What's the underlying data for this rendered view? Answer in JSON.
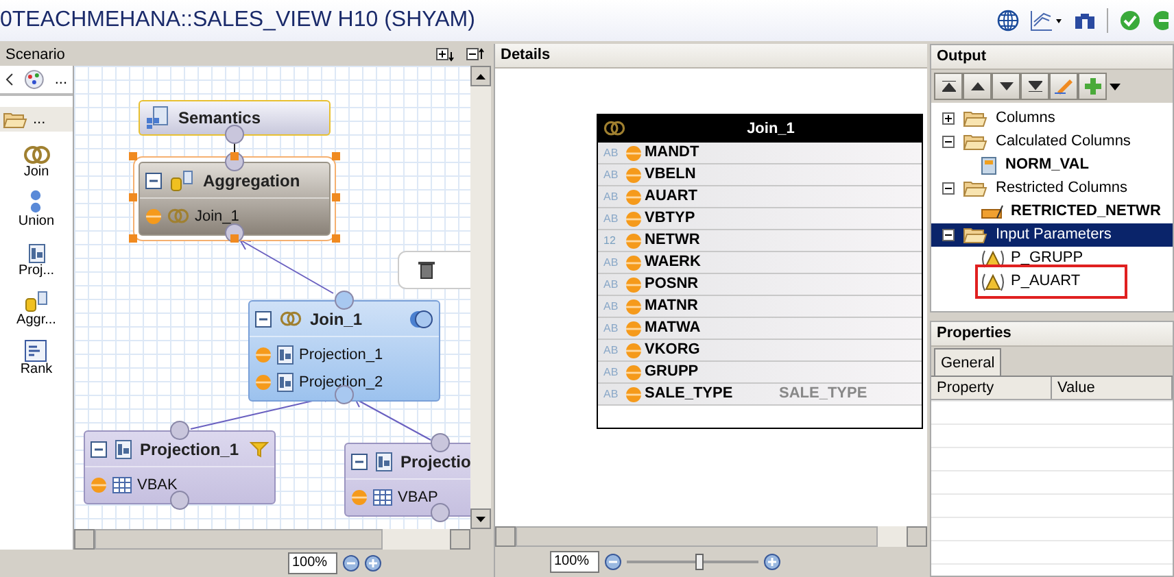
{
  "window": {
    "title": "0TEACHMEHANA::SALES_VIEW H10 (SHYAM)"
  },
  "scenario": {
    "title": "Scenario",
    "palette_header": "...",
    "palette_folder": "...",
    "palette": [
      {
        "kind": "join",
        "label": "Join"
      },
      {
        "kind": "union",
        "label": "Union"
      },
      {
        "kind": "projection",
        "label": "Proj..."
      },
      {
        "kind": "aggregation",
        "label": "Aggr..."
      },
      {
        "kind": "rank",
        "label": "Rank"
      }
    ],
    "nodes": [
      {
        "kind": "semantics",
        "title": "Semantics",
        "selected": false,
        "collapsible": false
      },
      {
        "kind": "aggregation",
        "title": "Aggregation",
        "selected": true,
        "collapsible": true,
        "items": [
          {
            "kind": "join",
            "label": "Join_1"
          }
        ]
      },
      {
        "kind": "join",
        "title": "Join_1",
        "selected": false,
        "collapsible": true,
        "items": [
          {
            "kind": "projection",
            "label": "Projection_1"
          },
          {
            "kind": "projection",
            "label": "Projection_2"
          }
        ]
      },
      {
        "kind": "projection",
        "title": "Projection_1",
        "selected": false,
        "collapsible": true,
        "filtered": true,
        "items": [
          {
            "kind": "table",
            "label": "VBAK"
          }
        ]
      },
      {
        "kind": "projection",
        "title": "Projectio",
        "selected": false,
        "collapsible": true,
        "filtered": false,
        "items": [
          {
            "kind": "table",
            "label": "VBAP"
          }
        ]
      }
    ],
    "zoom": "100%"
  },
  "details": {
    "title": "Details",
    "table": {
      "title": "Join_1",
      "rows": [
        {
          "type": "AB",
          "name": "MANDT"
        },
        {
          "type": "AB",
          "name": "VBELN"
        },
        {
          "type": "AB",
          "name": "AUART"
        },
        {
          "type": "AB",
          "name": "VBTYP"
        },
        {
          "type": "12",
          "name": "NETWR"
        },
        {
          "type": "AB",
          "name": "WAERK"
        },
        {
          "type": "AB",
          "name": "POSNR"
        },
        {
          "type": "AB",
          "name": "MATNR"
        },
        {
          "type": "AB",
          "name": "MATWA"
        },
        {
          "type": "AB",
          "name": "VKORG"
        },
        {
          "type": "AB",
          "name": "GRUPP"
        },
        {
          "type": "AB",
          "name": "SALE_TYPE",
          "value": "SALE_TYPE"
        }
      ]
    },
    "zoom": "100%",
    "slider": {
      "level": 0.55
    }
  },
  "output": {
    "title": "Output",
    "tree": [
      {
        "kind": "folder",
        "label": "Columns",
        "expanded": false,
        "selected": false
      },
      {
        "kind": "folder",
        "label": "Calculated Columns",
        "expanded": true,
        "selected": false,
        "children": [
          {
            "kind": "calculated",
            "label": "NORM_VAL",
            "highlighted": false
          }
        ]
      },
      {
        "kind": "folder",
        "label": "Restricted Columns",
        "expanded": true,
        "selected": false,
        "children": [
          {
            "kind": "restricted",
            "label": "RETRICTED_NETWR",
            "highlighted": false
          }
        ]
      },
      {
        "kind": "folder",
        "label": "Input Parameters",
        "expanded": true,
        "selected": true,
        "children": [
          {
            "kind": "parameter",
            "label": "P_GRUPP",
            "highlighted": false
          },
          {
            "kind": "parameter",
            "label": "P_AUART",
            "highlighted": true
          }
        ]
      }
    ]
  },
  "properties": {
    "title": "Properties",
    "tabs": [
      {
        "label": "General",
        "selected": true
      }
    ],
    "columns": [
      "Property",
      "Value"
    ]
  }
}
